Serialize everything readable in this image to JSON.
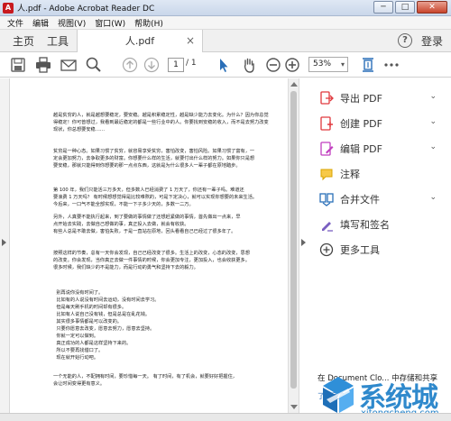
{
  "window": {
    "title": "人.pdf - Adobe Acrobat Reader DC",
    "app_icon_glyph": "A",
    "minimize_glyph": "─",
    "maximize_glyph": "□",
    "close_glyph": "✕"
  },
  "menu": [
    "文件",
    "编辑",
    "视图(V)",
    "窗口(W)",
    "帮助(H)"
  ],
  "tabs": {
    "home": "主页",
    "tools": "工具",
    "document": "人.pdf",
    "close_glyph": "×"
  },
  "header_right": {
    "help_glyph": "?",
    "login": "登录"
  },
  "toolbar": {
    "page_current": "1",
    "page_total": "/ 1",
    "zoom": "53%",
    "zoom_dropdown_glyph": "▾"
  },
  "document": {
    "paragraphs": [
      "越是贫穷的人，就是越想要稳定，要安稳。越是积累稳定性，越是缺少能力去变化。为什么？因为你总觉\n得稳定！你可曾想过，我看到最近稳定的都是一些行业中的人。你要找到安稳的收入，而不是去努力改变\n现状，你总想要安稳……",
      "贫穷是一种心态。如果习惯了贫穷，就容易享受贫穷，害怕改变，害怕风险。如果习惯了富有，一\n定会更加努力，去争取更多的财富。你想要什么样的生活，就要付出什么样的努力。如果你只是想\n要安稳，那就只能得到你想要的那一点点东西，这就是为什么很多人一辈子都在原地踏步。",
      "第 100 年，我们只能活三万多天，但多数人已经消费了 1 万天了，你还有一辈子吗。难道还\n要浪费 1 万天吗？ 有时候想想觉得是比较难熬的，可是下定决心，就可以实现你想要的未来生活。\n今后来，一口气不能全部实现，不能一下子多少天的，多数一二万。",
      "另外，人真要不能执行起来，到了要做的事情做了还想赶紧做的事情，首先做出一点来，早\n点开始去实践，去做自己想做的事，真正投入去做，就会有收获。\n有些人总是不敢去做，害怕失败，于是一直站在原地，回头看看自己已经过了很多年了。",
      "按照这样的节奏，总有一天你会发现，自己已经改变了很多。生活上的改变，心态的改变，思想\n的改变。你会发现，当你真正去做一件事情的时候，你会更加专注，更加投入，也会收获更多。\n很多时候，我们缺少的不是能力，而是行动的勇气和坚持下去的毅力。",
      "  别再说你没有时间了。\n  比如有的人说没有时间去运动，没有时间去学习。\n  但是每天刷手机的时间却有很多。\n  比如有人说自己没有钱，但是总是在乱花钱。\n  其实很多事情都是可以改变的。\n  只要你愿意去改变，愿意去努力，愿意去坚持。\n  你就一定可以做到。\n  真正成功的人都是这样坚持下来的。\n  所以不要再找借口了。\n  现在就开始行动吧。",
      "一个无能的人，不配拥有时间，要珍惜每一天。 有了时间，有了机会，就要好好把握住，\n会让时间变得更有意义。"
    ]
  },
  "tools_panel": [
    {
      "label": "导出 PDF",
      "icon": "export-pdf-icon",
      "color": "#e0393e",
      "has_chevron": true
    },
    {
      "label": "创建 PDF",
      "icon": "create-pdf-icon",
      "color": "#e0393e",
      "has_chevron": true
    },
    {
      "label": "编辑 PDF",
      "icon": "edit-pdf-icon",
      "color": "#c13fbf",
      "has_chevron": true
    },
    {
      "label": "注释",
      "icon": "comment-icon",
      "color": "#f0b400",
      "has_chevron": false
    },
    {
      "label": "合并文件",
      "icon": "combine-files-icon",
      "color": "#2a6fb8",
      "has_chevron": true
    },
    {
      "label": "填写和签名",
      "icon": "fill-sign-icon",
      "color": "#7a5fc1",
      "has_chevron": false
    },
    {
      "label": "更多工具",
      "icon": "more-tools-icon",
      "color": "#444444",
      "has_chevron": false
    }
  ],
  "chevron_glyph": "⌄",
  "cloud": {
    "text": "在 Document Clo... 中存储和共享",
    "sub": "了解更多"
  },
  "watermark": {
    "title": "系统城",
    "url": "xitongcheng.com"
  },
  "colors": {
    "accent_blue": "#2a6fb8",
    "acrobat_red": "#c8191e"
  }
}
